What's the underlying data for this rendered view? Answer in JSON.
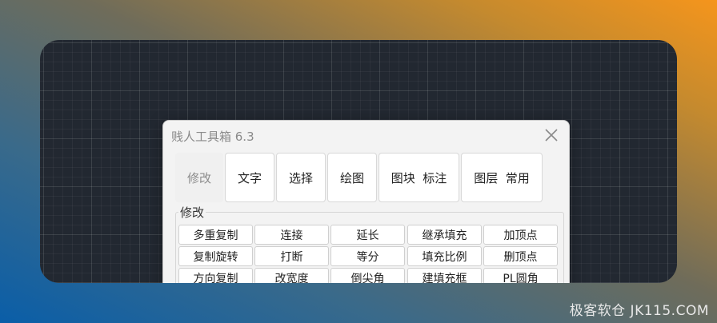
{
  "dialog": {
    "title": "贱人工具箱 6.3",
    "tabs": [
      "修改",
      "文字",
      "选择",
      "绘图",
      "图块  标注",
      "图层  常用"
    ],
    "active_tab": "修改",
    "group_label": "修改",
    "buttons": [
      [
        "多重复制",
        "连接",
        "延长",
        "继承填充",
        "加顶点"
      ],
      [
        "复制旋转",
        "打断",
        "等分",
        "填充比例",
        "删顶点"
      ],
      [
        "方向复制",
        "改宽度",
        "倒尖角",
        "建填充框",
        "PL圆角"
      ]
    ]
  },
  "watermark": "极客软仓 JK115.COM",
  "icons": {
    "close": "close-icon"
  }
}
